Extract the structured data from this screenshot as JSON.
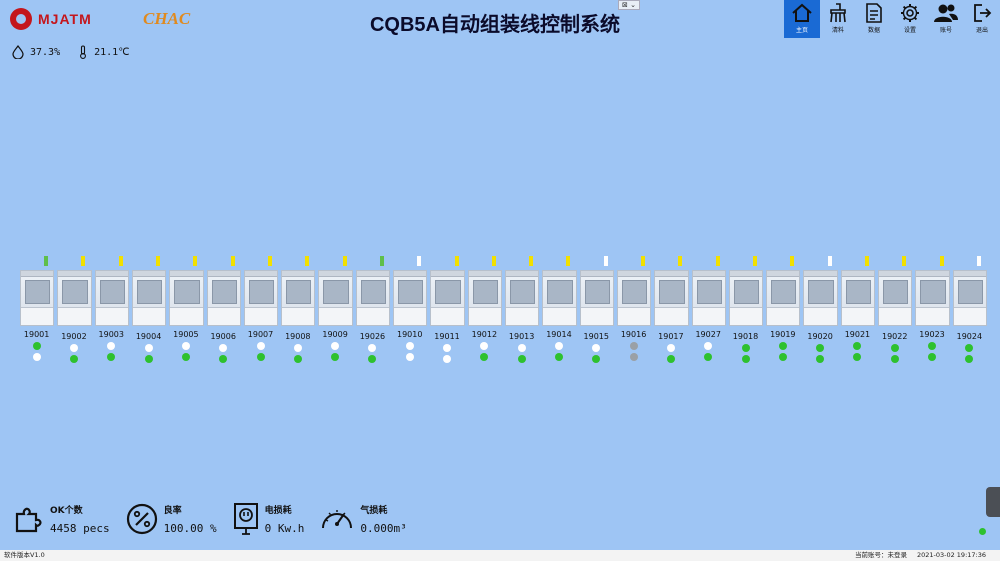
{
  "header": {
    "brand": "MJATM",
    "brand2": "CHAC",
    "title": "CQB5A自动组装线控制系统",
    "window_ctrl": "⊠ ⌄"
  },
  "env": {
    "humidity": "37.3%",
    "temperature": "21.1℃"
  },
  "nav": [
    {
      "key": "home",
      "label": "主页",
      "icon": "home-icon",
      "active": true
    },
    {
      "key": "material",
      "label": "清料",
      "icon": "broom-icon",
      "active": false
    },
    {
      "key": "data",
      "label": "数据",
      "icon": "document-icon",
      "active": false
    },
    {
      "key": "settings",
      "label": "设置",
      "icon": "gear-icon",
      "active": false
    },
    {
      "key": "account",
      "label": "账号",
      "icon": "users-icon",
      "active": false
    },
    {
      "key": "exit",
      "label": "退出",
      "icon": "exit-icon",
      "active": false
    }
  ],
  "stations": [
    {
      "id": "19001",
      "dots": [
        "green",
        "white"
      ]
    },
    {
      "id": "19002",
      "dots": [
        "white",
        "green"
      ]
    },
    {
      "id": "19003",
      "dots": [
        "white",
        "green"
      ]
    },
    {
      "id": "19004",
      "dots": [
        "white",
        "green"
      ]
    },
    {
      "id": "19005",
      "dots": [
        "white",
        "green"
      ]
    },
    {
      "id": "19006",
      "dots": [
        "white",
        "green"
      ]
    },
    {
      "id": "19007",
      "dots": [
        "white",
        "green"
      ]
    },
    {
      "id": "19008",
      "dots": [
        "white",
        "green"
      ]
    },
    {
      "id": "19009",
      "dots": [
        "white",
        "green"
      ]
    },
    {
      "id": "19026",
      "dots": [
        "white",
        "green"
      ]
    },
    {
      "id": "19010",
      "dots": [
        "white",
        "white"
      ]
    },
    {
      "id": "19011",
      "dots": [
        "white",
        "white"
      ]
    },
    {
      "id": "19012",
      "dots": [
        "white",
        "green"
      ]
    },
    {
      "id": "19013",
      "dots": [
        "white",
        "green"
      ]
    },
    {
      "id": "19014",
      "dots": [
        "white",
        "green"
      ]
    },
    {
      "id": "19015",
      "dots": [
        "white",
        "green"
      ]
    },
    {
      "id": "19016",
      "dots": [
        "gray",
        "gray"
      ]
    },
    {
      "id": "19017",
      "dots": [
        "white",
        "green"
      ]
    },
    {
      "id": "19027",
      "dots": [
        "white",
        "green"
      ]
    },
    {
      "id": "19018",
      "dots": [
        "green",
        "green"
      ]
    },
    {
      "id": "19019",
      "dots": [
        "green",
        "green"
      ]
    },
    {
      "id": "19020",
      "dots": [
        "green",
        "green"
      ]
    },
    {
      "id": "19021",
      "dots": [
        "green",
        "green"
      ]
    },
    {
      "id": "19022",
      "dots": [
        "green",
        "green"
      ]
    },
    {
      "id": "19023",
      "dots": [
        "green",
        "green"
      ]
    },
    {
      "id": "19024",
      "dots": [
        "green",
        "green"
      ]
    }
  ],
  "stats": {
    "ok_label": "OK个数",
    "ok_value": "4458 pecs",
    "yield_label": "良率",
    "yield_value": "100.00 %",
    "power_label": "电损耗",
    "power_value": "0 Kw.h",
    "gas_label": "气损耗",
    "gas_value": "0.000m³"
  },
  "status_bar": {
    "version": "软件版本V1.0",
    "account": "当前账号：未登录",
    "datetime": "2021-03-02 19:17:36"
  },
  "colors": {
    "background": "#9ec5f4",
    "active_nav": "#1a6ad4",
    "ok": "#2ec12e",
    "idle": "#ffffff",
    "offline": "#9aa0a6"
  }
}
